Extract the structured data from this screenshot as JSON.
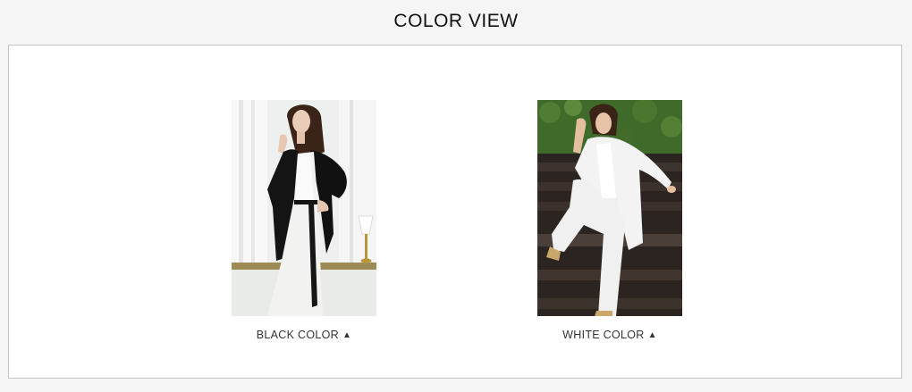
{
  "page": {
    "title": "COLOR VIEW"
  },
  "variants": [
    {
      "label": "BLACK COLOR",
      "arrow": "▲",
      "arrow_icon": "triangle-up-icon"
    },
    {
      "label": "WHITE COLOR",
      "arrow": "▲",
      "arrow_icon": "triangle-up-icon"
    }
  ],
  "colors": {
    "frame_border": "#c4c4c4",
    "page_background": "#f5f5f5",
    "panel_background": "#ffffff"
  }
}
